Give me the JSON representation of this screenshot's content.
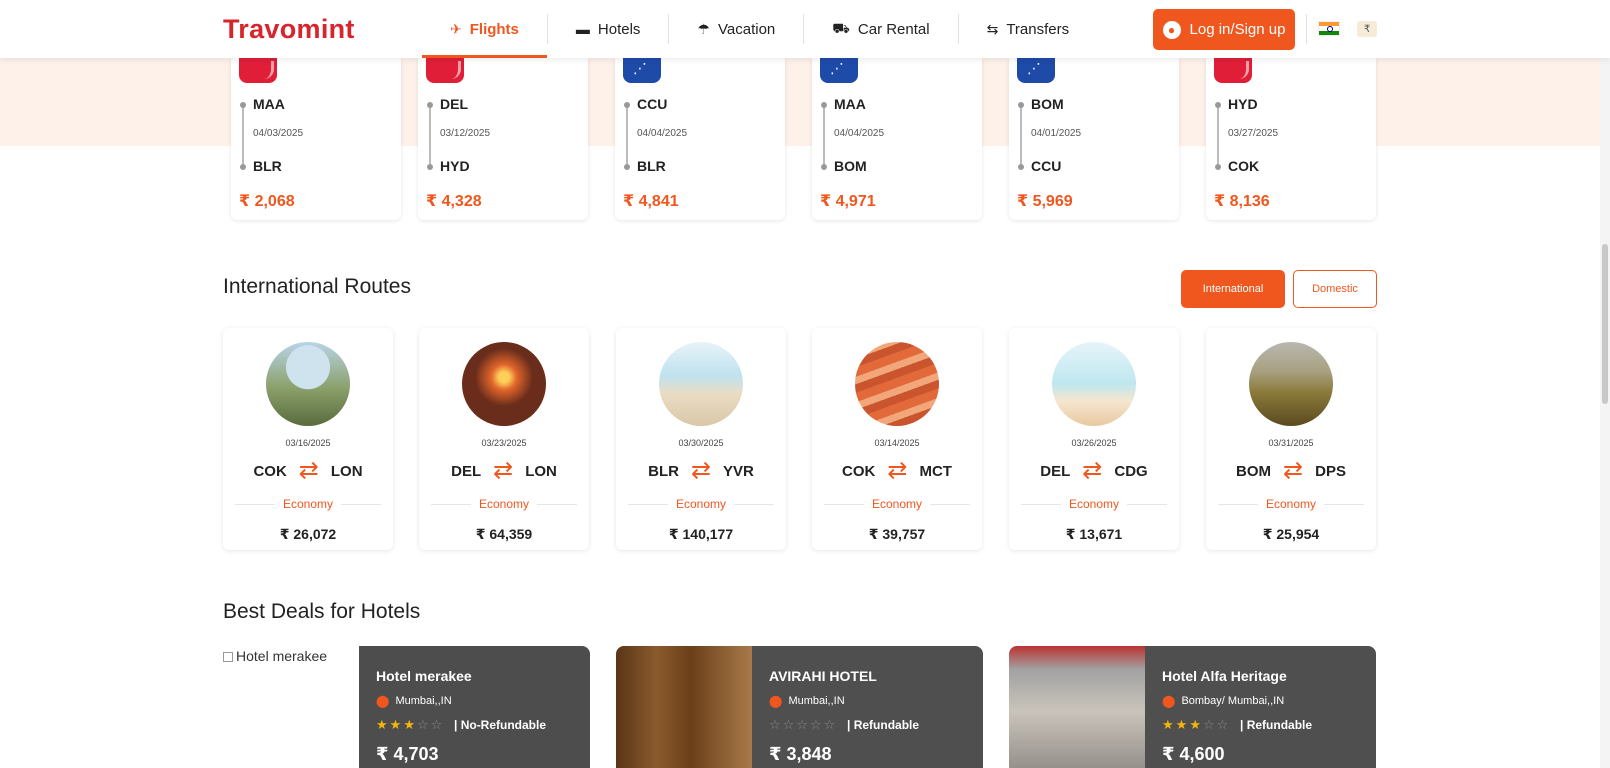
{
  "header": {
    "logo": "Travomint",
    "nav": [
      {
        "label": "Flights",
        "icon": "plane-icon",
        "glyph": "✈"
      },
      {
        "label": "Hotels",
        "icon": "bed-icon",
        "glyph": "🛏"
      },
      {
        "label": "Vacation",
        "icon": "umbrella-icon",
        "glyph": "⛱"
      },
      {
        "label": "Car Rental",
        "icon": "car-icon",
        "glyph": "🚗"
      },
      {
        "label": "Transfers",
        "icon": "transfer-icon",
        "glyph": "⇄"
      }
    ],
    "login": "Log in/Sign up",
    "currency": "₹"
  },
  "domestic_routes": [
    {
      "airline": "red",
      "from": "MAA",
      "date": "04/03/2025",
      "to": "BLR",
      "price": "₹ 2,068"
    },
    {
      "airline": "red",
      "from": "DEL",
      "date": "03/12/2025",
      "to": "HYD",
      "price": "₹ 4,328"
    },
    {
      "airline": "blue",
      "from": "CCU",
      "date": "04/04/2025",
      "to": "BLR",
      "price": "₹ 4,841"
    },
    {
      "airline": "blue",
      "from": "MAA",
      "date": "04/04/2025",
      "to": "BOM",
      "price": "₹ 4,971"
    },
    {
      "airline": "blue",
      "from": "BOM",
      "date": "04/01/2025",
      "to": "CCU",
      "price": "₹ 5,969"
    },
    {
      "airline": "red",
      "from": "HYD",
      "date": "03/27/2025",
      "to": "COK",
      "price": "₹ 8,136"
    }
  ],
  "international": {
    "title": "International Routes",
    "toggle_on": "International",
    "toggle_off": "Domestic",
    "routes": [
      {
        "date": "03/16/2025",
        "from": "COK",
        "to": "LON",
        "class": "Economy",
        "price": "₹ 26,072"
      },
      {
        "date": "03/23/2025",
        "from": "DEL",
        "to": "LON",
        "class": "Economy",
        "price": "₹ 64,359"
      },
      {
        "date": "03/30/2025",
        "from": "BLR",
        "to": "YVR",
        "class": "Economy",
        "price": "₹ 140,177"
      },
      {
        "date": "03/14/2025",
        "from": "COK",
        "to": "MCT",
        "class": "Economy",
        "price": "₹ 39,757"
      },
      {
        "date": "03/26/2025",
        "from": "DEL",
        "to": "CDG",
        "class": "Economy",
        "price": "₹ 13,671"
      },
      {
        "date": "03/31/2025",
        "from": "BOM",
        "to": "DPS",
        "class": "Economy",
        "price": "₹ 25,954"
      }
    ]
  },
  "hotels": {
    "title": "Best Deals for Hotels",
    "alt_text": "Hotel merakee",
    "items": [
      {
        "name": "Hotel merakee",
        "location": "Mumbai,,IN",
        "stars": 3,
        "refund": "| No-Refundable",
        "price": "₹  4,703"
      },
      {
        "name": "AVIRAHI HOTEL",
        "location": "Mumbai,,IN",
        "stars": 0,
        "refund": "| Refundable",
        "price": "₹  3,848"
      },
      {
        "name": "Hotel Alfa Heritage",
        "location": "Bombay/ Mumbai,,IN",
        "stars": 3,
        "refund": "| Refundable",
        "price": "₹  4,600"
      }
    ]
  },
  "colors": {
    "accent": "#f0571e",
    "brand": "#d6262b"
  }
}
